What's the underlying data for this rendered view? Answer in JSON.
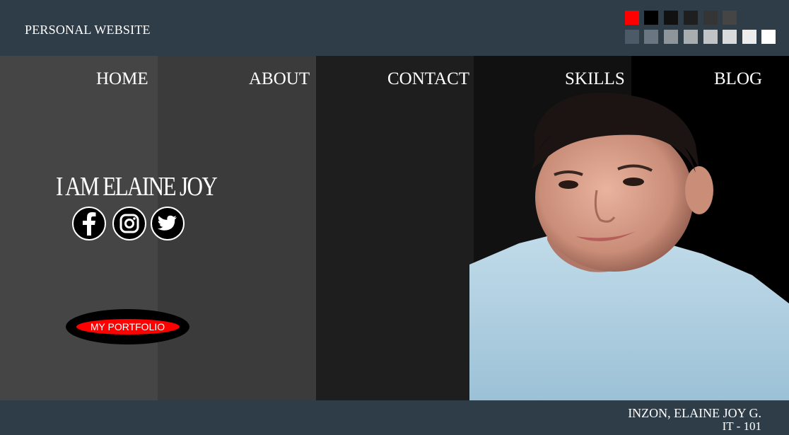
{
  "header": {
    "site_title": "PERSONAL WEBSITE",
    "palette": [
      "#ff0000",
      "#000000",
      "#111111",
      "#1f1f1f",
      "#353535",
      "#454545",
      "#4b5a66",
      "#6b7780",
      "#8e969c",
      "#a8adb0",
      "#c1c4c6",
      "#d8dadb",
      "#ececec",
      "#ffffff"
    ]
  },
  "nav": {
    "items": [
      "HOME",
      "ABOUT",
      "CONTACT",
      "SKILLS",
      "BLOG"
    ]
  },
  "hero": {
    "headline": "I AM ELAINE JOY",
    "social_icons": [
      "facebook-icon",
      "instagram-icon",
      "twitter-icon"
    ],
    "portfolio_button": "MY PORTFOLIO"
  },
  "footer": {
    "name": "INZON, ELAINE JOY G.",
    "section": "IT - 101"
  }
}
